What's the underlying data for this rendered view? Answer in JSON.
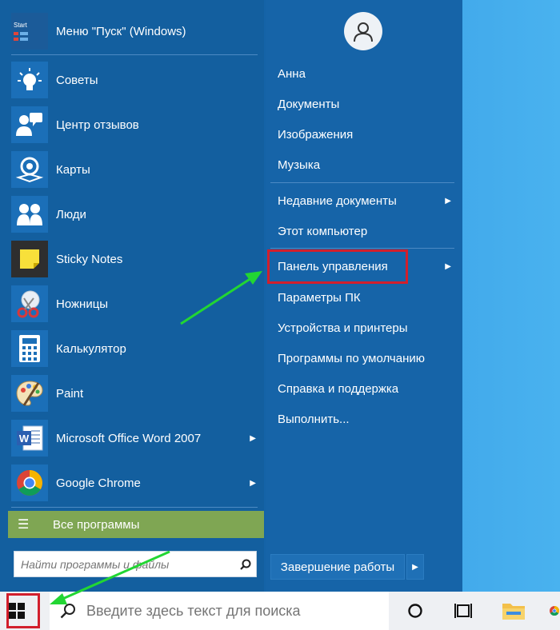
{
  "start_menu": {
    "apps": [
      {
        "label": "Меню \"Пуск\" (Windows)",
        "icon": "start-menu-tile-icon",
        "tile_text": "Start",
        "has_submenu": false
      },
      {
        "label": "Советы",
        "icon": "lightbulb-icon",
        "has_submenu": false
      },
      {
        "label": "Центр отзывов",
        "icon": "feedback-hub-icon",
        "has_submenu": false
      },
      {
        "label": "Карты",
        "icon": "maps-icon",
        "has_submenu": false
      },
      {
        "label": "Люди",
        "icon": "people-icon",
        "has_submenu": false
      },
      {
        "label": "Sticky Notes",
        "icon": "sticky-notes-icon",
        "has_submenu": false
      },
      {
        "label": "Ножницы",
        "icon": "snipping-tool-icon",
        "has_submenu": false
      },
      {
        "label": "Калькулятор",
        "icon": "calculator-icon",
        "has_submenu": false
      },
      {
        "label": "Paint",
        "icon": "paint-palette-icon",
        "has_submenu": false
      },
      {
        "label": "Microsoft Office Word 2007",
        "icon": "word-icon",
        "has_submenu": true
      },
      {
        "label": "Google Chrome",
        "icon": "chrome-icon",
        "has_submenu": true
      }
    ],
    "all_programs": "Все программы",
    "search_placeholder": "Найти программы и файлы",
    "right_items": [
      {
        "label": "Анна",
        "has_submenu": false
      },
      {
        "label": "Документы",
        "has_submenu": false
      },
      {
        "label": "Изображения",
        "has_submenu": false
      },
      {
        "label": "Музыка",
        "has_submenu": false
      },
      {
        "label": "Недавние документы",
        "has_submenu": true
      },
      {
        "label": "Этот компьютер",
        "has_submenu": false
      },
      {
        "label": "Панель управления",
        "has_submenu": true,
        "highlighted": true
      },
      {
        "label": "Параметры ПК",
        "has_submenu": false
      },
      {
        "label": "Устройства и принтеры",
        "has_submenu": false
      },
      {
        "label": "Программы по умолчанию",
        "has_submenu": false
      },
      {
        "label": "Справка и поддержка",
        "has_submenu": false
      },
      {
        "label": "Выполнить...",
        "has_submenu": false
      }
    ],
    "shutdown_label": "Завершение работы"
  },
  "taskbar": {
    "search_placeholder": "Введите здесь текст для поиска"
  },
  "colors": {
    "menu_bg": "#135f9f",
    "all_programs_bg": "#7fa653",
    "highlight_border": "#d21f2c",
    "annotation_arrow": "#22d633"
  }
}
